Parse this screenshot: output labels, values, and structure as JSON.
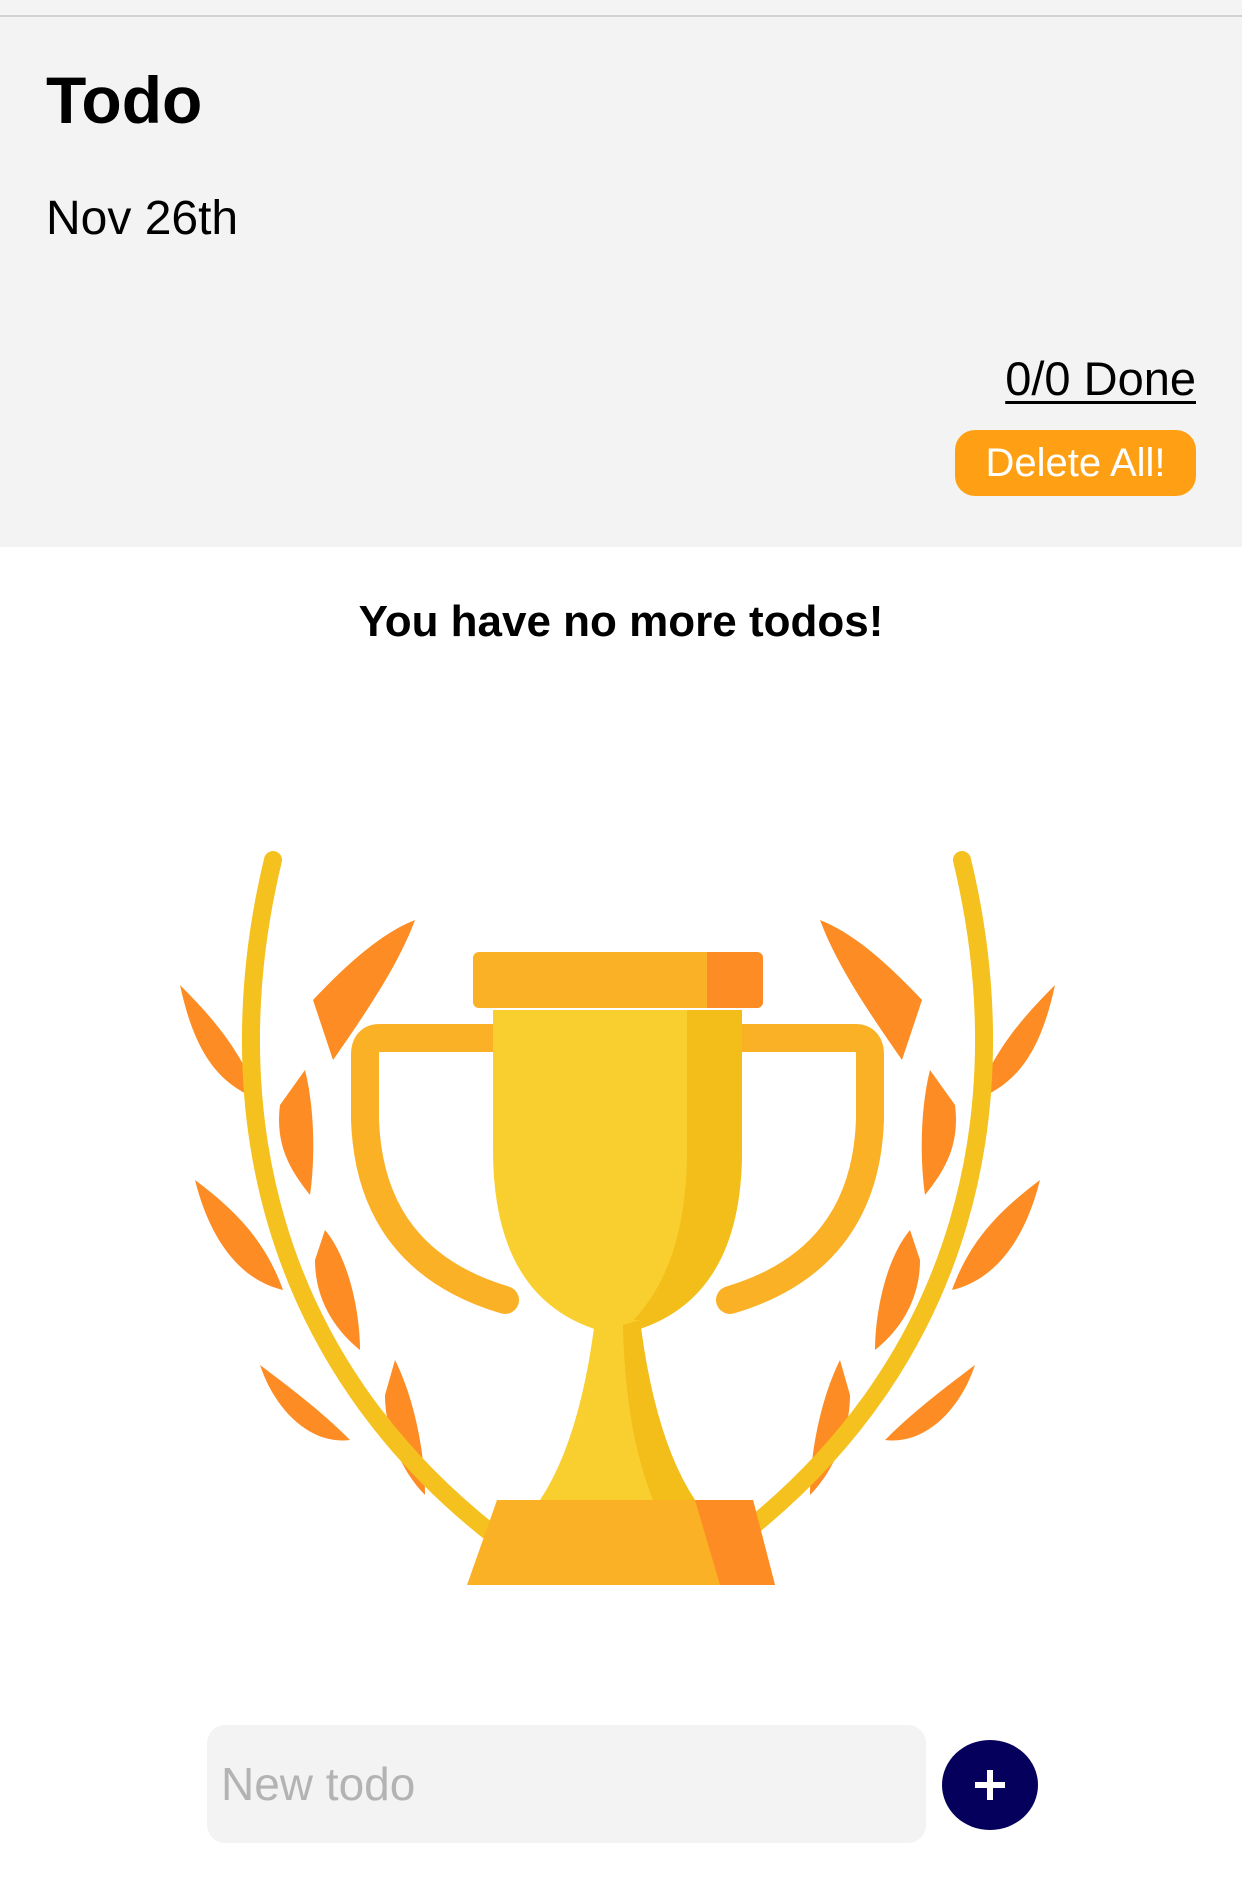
{
  "header": {
    "title": "Todo",
    "date": "Nov 26th",
    "done_counter": "0/0 Done",
    "delete_all_label": "Delete All!"
  },
  "main": {
    "empty_message": "You have no more todos!",
    "illustration_icon": "trophy-icon"
  },
  "new_todo": {
    "value": "",
    "placeholder": "New todo",
    "add_icon": "plus-icon"
  },
  "colors": {
    "accent": "#ffa014",
    "add_button": "#05005c",
    "header_background": "#f3f3f3",
    "trophy_gold": "#f9cf2f",
    "trophy_orange": "#fc8c23"
  }
}
